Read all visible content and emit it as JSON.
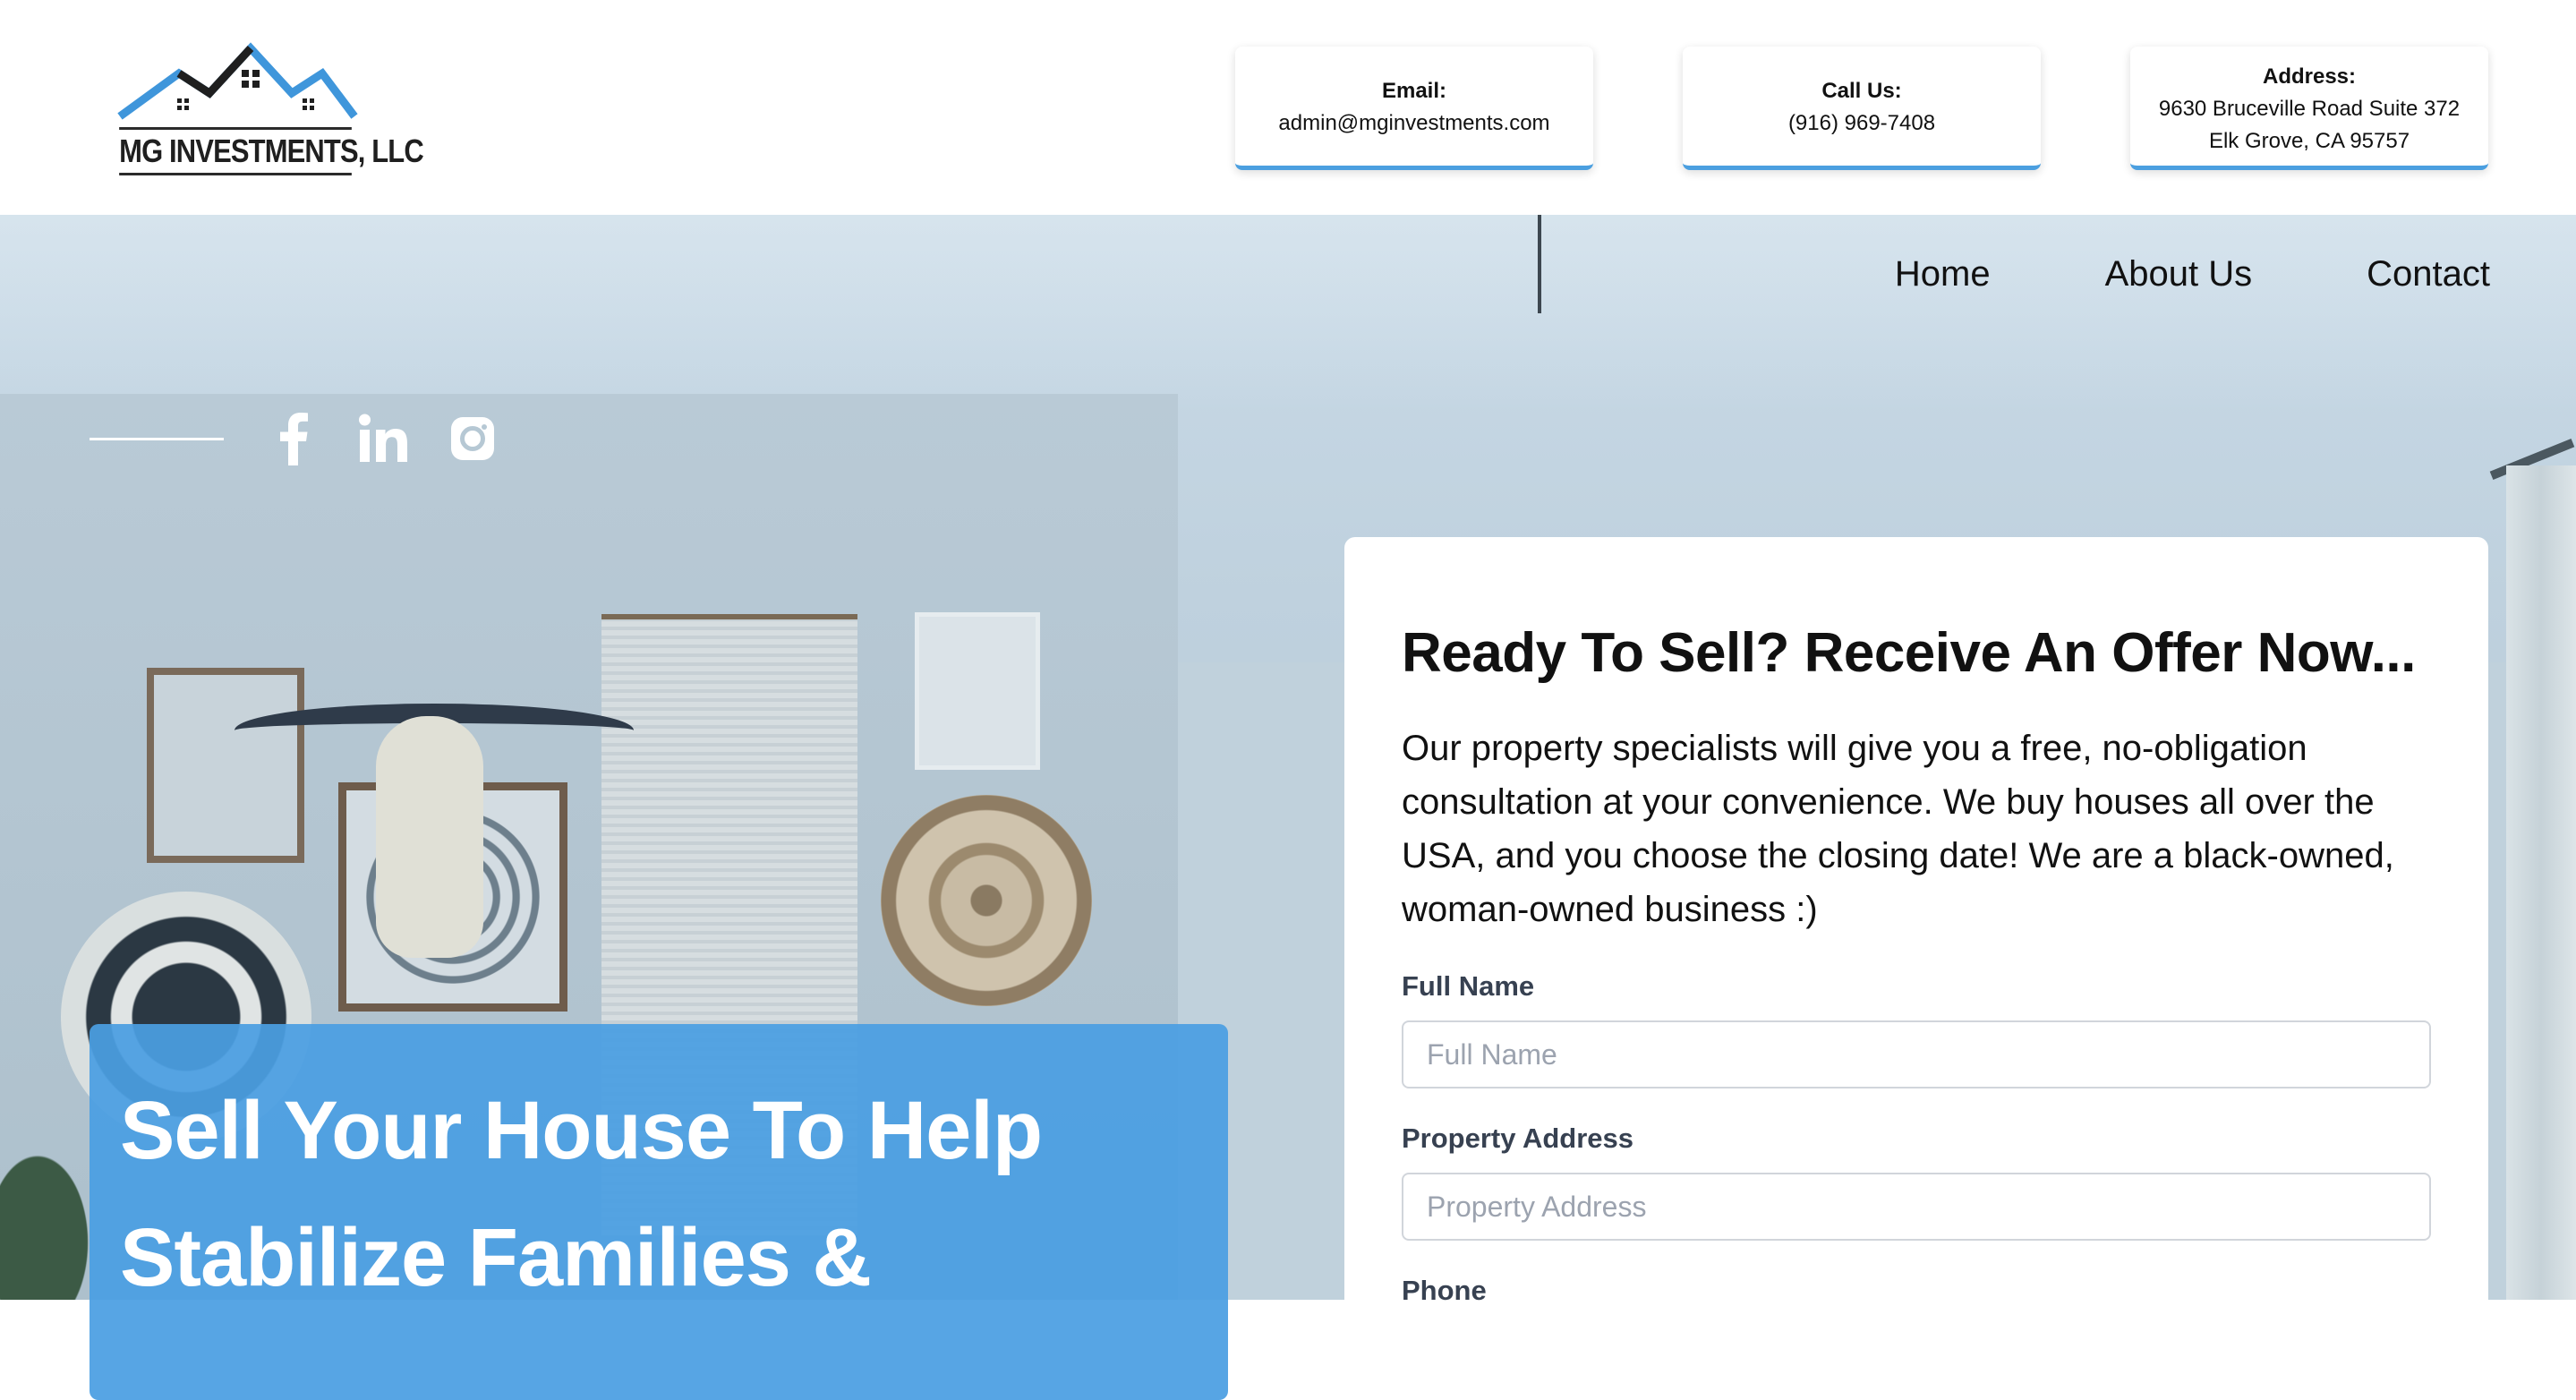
{
  "brand": {
    "logo_text": "MG INVESTMENTS, LLC"
  },
  "contact": {
    "email_label": "Email:",
    "email_value": "admin@mginvestments.com",
    "call_label": "Call Us:",
    "call_value": "(916) 969-7408",
    "address_label": "Address:",
    "address_line1": "9630 Bruceville Road Suite 372",
    "address_line2": "Elk Grove, CA 95757"
  },
  "nav": {
    "items": [
      {
        "label": "Home"
      },
      {
        "label": "About Us"
      },
      {
        "label": "Contact"
      }
    ]
  },
  "social": {
    "icons": [
      "facebook-icon",
      "linkedin-icon",
      "instagram-icon"
    ]
  },
  "hero": {
    "headline_line1": "Sell Your House To Help",
    "headline_line2": "Stabilize Families &"
  },
  "form": {
    "title": "Ready To Sell? Receive An Offer Now...",
    "intro": "Our property specialists will give you a free, no-obligation consultation at your convenience. We buy houses all over the USA, and you choose the closing date! We are a black-owned, woman-owned business :)",
    "fields": [
      {
        "label": "Full Name",
        "placeholder": "Full Name"
      },
      {
        "label": "Property Address",
        "placeholder": "Property Address"
      },
      {
        "label": "Phone"
      }
    ]
  },
  "colors": {
    "accent_blue": "#4a9ee2",
    "card_border_blue": "#4b9fe0",
    "label_gray": "#374151"
  }
}
